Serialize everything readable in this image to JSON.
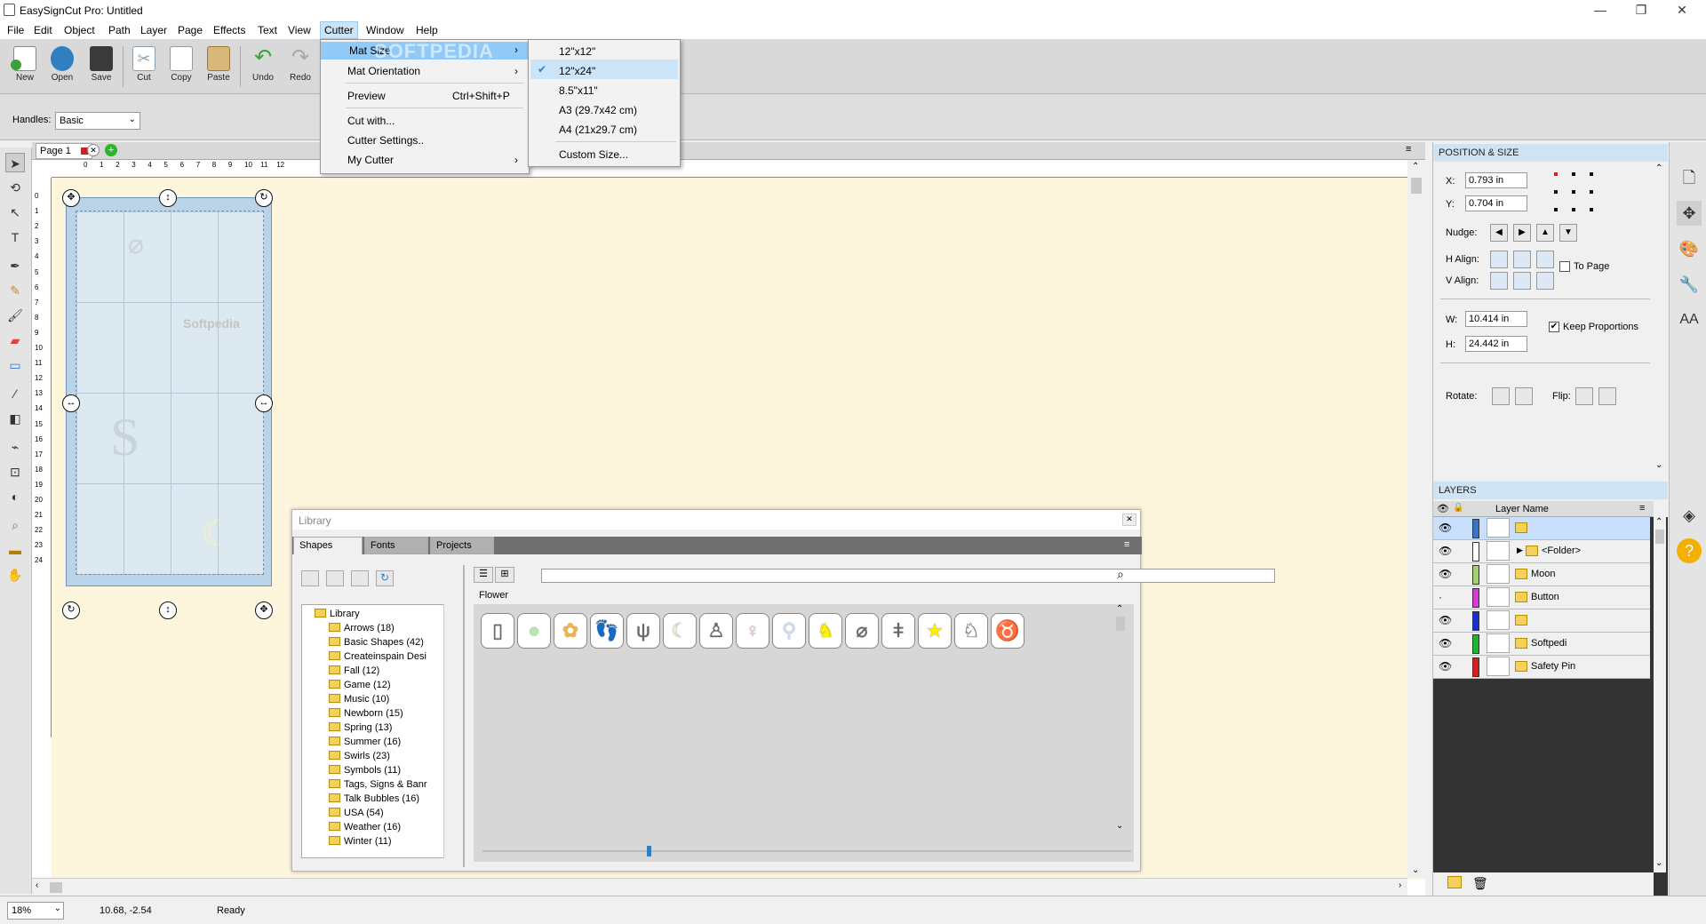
{
  "window": {
    "title": "EasySignCut Pro: Untitled",
    "minimize": "—",
    "maximize": "❐",
    "close": "✕"
  },
  "menubar": [
    "File",
    "Edit",
    "Object",
    "Path",
    "Layer",
    "Page",
    "Effects",
    "Text",
    "View",
    "Cutter",
    "Window",
    "Help"
  ],
  "toolbar": [
    {
      "label": "New",
      "icon": "new-document-icon",
      "color": "#3aa13a"
    },
    {
      "label": "Open",
      "icon": "open-folder-icon",
      "color": "#2f7fc1"
    },
    {
      "label": "Save",
      "icon": "save-disk-icon",
      "color": "#3a3a3a"
    },
    {
      "label": "Cut",
      "icon": "scissors-icon",
      "color": "#8aa0b0"
    },
    {
      "label": "Copy",
      "icon": "copy-icon",
      "color": "#c9c9c9"
    },
    {
      "label": "Paste",
      "icon": "paste-icon",
      "color": "#c9a56a"
    },
    {
      "label": "Undo",
      "icon": "undo-icon",
      "color": "#3aa13a"
    },
    {
      "label": "Redo",
      "icon": "redo-icon",
      "color": "#a8a8a8"
    }
  ],
  "propbar": {
    "handles_label": "Handles:",
    "handles_value": "Basic"
  },
  "cutter_menu": {
    "items": [
      {
        "label": "Mat Size",
        "shortcut": "",
        "submenu": true
      },
      {
        "label": "Mat Orientation",
        "shortcut": "",
        "submenu": true
      },
      {
        "label": "Preview",
        "shortcut": "Ctrl+Shift+P",
        "submenu": false
      },
      {
        "label": "Cut with...",
        "shortcut": "",
        "submenu": false
      },
      {
        "label": "Cutter Settings..",
        "shortcut": "",
        "submenu": false
      },
      {
        "label": "My Cutter",
        "shortcut": "",
        "submenu": true
      }
    ],
    "watermark": "SOFTPEDIA"
  },
  "mat_size_menu": {
    "items": [
      "12\"x12\"",
      "12\"x24\"",
      "8.5\"x11\"",
      "A3 (29.7x42 cm)",
      "A4 (21x29.7 cm)",
      "Custom Size..."
    ],
    "checked": "12\"x24\""
  },
  "page_tab": {
    "label": "Page 1"
  },
  "ruler_h": [
    "0",
    "1",
    "2",
    "3",
    "4",
    "5",
    "6",
    "7",
    "8",
    "9",
    "10",
    "11",
    "12"
  ],
  "ruler_v": [
    "0",
    "1",
    "2",
    "3",
    "4",
    "5",
    "6",
    "7",
    "8",
    "9",
    "10",
    "11",
    "12",
    "13",
    "14",
    "15",
    "16",
    "17",
    "18",
    "19",
    "20",
    "21",
    "22",
    "23",
    "24"
  ],
  "mat_watermark": "Softpedia",
  "library": {
    "title": "Library",
    "tabs": [
      "Shapes",
      "Fonts",
      "Projects"
    ],
    "tree_root": "Library",
    "tree": [
      "Arrows (18)",
      "Basic Shapes (42)",
      "Createinspain Desi",
      "Fall (12)",
      "Game (12)",
      "Music (10)",
      "Newborn (15)",
      "Spring (13)",
      "Summer (16)",
      "Swirls (23)",
      "Symbols (11)",
      "Tags, Signs & Banr",
      "Talk Bubbles (16)",
      "USA (54)",
      "Weather (16)",
      "Winter (11)"
    ],
    "category": "Flower",
    "shapes": [
      {
        "name": "bottle-shape",
        "fill": "#ffffff",
        "glyph": "▯"
      },
      {
        "name": "button-shape",
        "fill": "#b7e8b0",
        "glyph": "●"
      },
      {
        "name": "flower-shape",
        "fill": "#f4b63a",
        "glyph": "✿"
      },
      {
        "name": "footprints-shape",
        "fill": "#ffffff",
        "glyph": "👣"
      },
      {
        "name": "fork-shape",
        "fill": "#ffffff",
        "glyph": "ψ"
      },
      {
        "name": "moon-shape",
        "fill": "#fbf6d4",
        "glyph": "☾"
      },
      {
        "name": "onesie-shape",
        "fill": "#ffffff",
        "glyph": "♙"
      },
      {
        "name": "pacifier-shape",
        "fill": "#f8d6e3",
        "glyph": "♀"
      },
      {
        "name": "rattle-shape",
        "fill": "#cfe3f7",
        "glyph": "⚲"
      },
      {
        "name": "duck-shape",
        "fill": "#fff200",
        "glyph": "♞"
      },
      {
        "name": "safety-pin-shape",
        "fill": "#ffffff",
        "glyph": "⌀"
      },
      {
        "name": "spoon-shape",
        "fill": "#ffffff",
        "glyph": "ǂ"
      },
      {
        "name": "star-shape",
        "fill": "#ffee00",
        "glyph": "★"
      },
      {
        "name": "stork-shape",
        "fill": "#ffffff",
        "glyph": "♘"
      },
      {
        "name": "teddy-bear-shape",
        "fill": "#8b4a25",
        "glyph": "♉"
      }
    ]
  },
  "position_size": {
    "header": "POSITION & SIZE",
    "x_label": "X:",
    "x_value": "0.793 in",
    "y_label": "Y:",
    "y_value": "0.704 in",
    "nudge_label": "Nudge:",
    "halign_label": "H Align:",
    "valign_label": "V Align:",
    "to_page_label": "To Page",
    "w_label": "W:",
    "w_value": "10.414 in",
    "h_label": "H:",
    "h_value": "24.442 in",
    "keep_proportions_label": "Keep Proportions",
    "rotate_label": "Rotate:",
    "flip_label": "Flip:"
  },
  "layers": {
    "header": "LAYERS",
    "col_name": "Layer Name",
    "rows": [
      {
        "name": "",
        "color": "#3b74c4",
        "selected": true,
        "folder": false,
        "visible": true
      },
      {
        "name": "<Folder>",
        "color": "#ffffff",
        "selected": false,
        "folder": true,
        "visible": true
      },
      {
        "name": "Moon",
        "color": "#a4d26c",
        "selected": false,
        "folder": false,
        "visible": true
      },
      {
        "name": "Button",
        "color": "#d43cd4",
        "selected": false,
        "folder": false,
        "visible": false
      },
      {
        "name": "",
        "color": "#1b2fd0",
        "selected": false,
        "folder": false,
        "visible": true
      },
      {
        "name": "Softpedi",
        "color": "#1fb52c",
        "selected": false,
        "folder": false,
        "visible": true
      },
      {
        "name": "Safety Pin",
        "color": "#d42020",
        "selected": false,
        "folder": false,
        "visible": true
      }
    ]
  },
  "status": {
    "zoom": "18%",
    "coords": "10.68, -2.54",
    "state": "Ready"
  }
}
